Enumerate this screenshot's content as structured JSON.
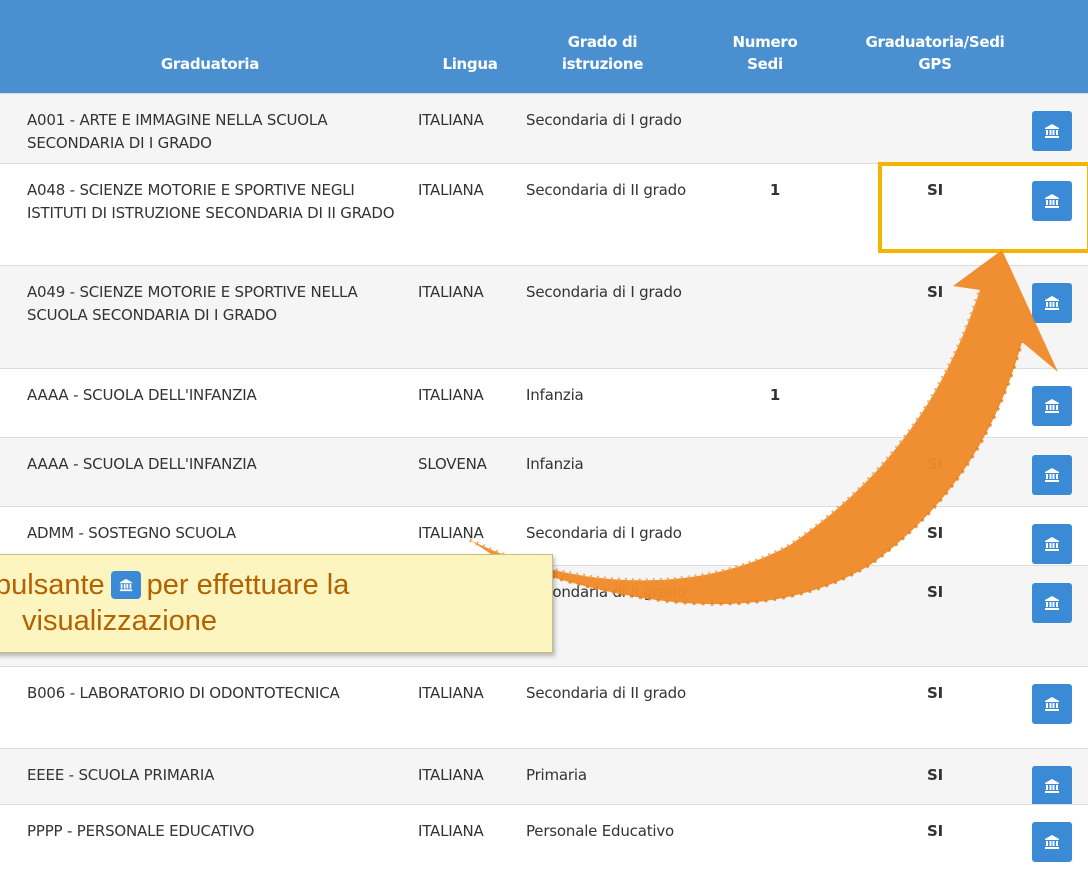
{
  "header": {
    "graduatoria": "Graduatoria",
    "lingua": "Lingua",
    "grado": [
      "Grado di",
      "istruzione"
    ],
    "numero": [
      "Numero",
      "Sedi"
    ],
    "gps": [
      "Graduatoria/Sedi",
      "GPS"
    ]
  },
  "rows": [
    {
      "graduatoria": "A001 - ARTE E IMMAGINE NELLA SCUOLA SECONDARIA DI I GRADO",
      "lingua": "ITALIANA",
      "grado": "Secondaria di I grado",
      "numero": "",
      "gps": ""
    },
    {
      "graduatoria": "A048 - SCIENZE MOTORIE E SPORTIVE NEGLI ISTITUTI DI ISTRUZIONE SECONDARIA DI II GRADO",
      "lingua": "ITALIANA",
      "grado": "Secondaria di II grado",
      "numero": "1",
      "gps": "SI"
    },
    {
      "graduatoria": "A049 - SCIENZE MOTORIE E SPORTIVE NELLA SCUOLA SECONDARIA DI I GRADO",
      "lingua": "ITALIANA",
      "grado": "Secondaria di I grado",
      "numero": "",
      "gps": "SI"
    },
    {
      "graduatoria": "AAAA - SCUOLA DELL'INFANZIA",
      "lingua": "ITALIANA",
      "grado": "Infanzia",
      "numero": "1",
      "gps": ""
    },
    {
      "graduatoria": "AAAA - SCUOLA DELL'INFANZIA",
      "lingua": "SLOVENA",
      "grado": "Infanzia",
      "numero": "",
      "gps": "SI"
    },
    {
      "graduatoria": "ADMM - SOSTEGNO SCUOLA",
      "lingua": "ITALIANA",
      "grado": "Secondaria di I grado",
      "numero": "",
      "gps": "SI"
    },
    {
      "graduatoria": "",
      "lingua": "",
      "grado": "Secondaria di II grado",
      "numero": "",
      "gps": "SI"
    },
    {
      "graduatoria": "B006 - LABORATORIO DI ODONTOTECNICA",
      "lingua": "ITALIANA",
      "grado": "Secondaria di II grado",
      "numero": "",
      "gps": "SI"
    },
    {
      "graduatoria": "EEEE - SCUOLA PRIMARIA",
      "lingua": "ITALIANA",
      "grado": "Primaria",
      "numero": "",
      "gps": "SI"
    },
    {
      "graduatoria": "PPPP - PERSONALE EDUCATIVO",
      "lingua": "ITALIANA",
      "grado": "Personale Educativo",
      "numero": "",
      "gps": "SI"
    }
  ],
  "callout": {
    "text_before": "pulsante",
    "text_after": "per effettuare la",
    "line2": "visualizzazione"
  },
  "colors": {
    "header_bg": "#4a90d0",
    "button_bg": "#3b8ad6",
    "highlight": "#f5b400",
    "arrow": "#ef8a2a",
    "callout_bg": "#fdf5c0",
    "callout_text": "#b36200"
  },
  "icons": {
    "row_button": "institution-icon"
  }
}
